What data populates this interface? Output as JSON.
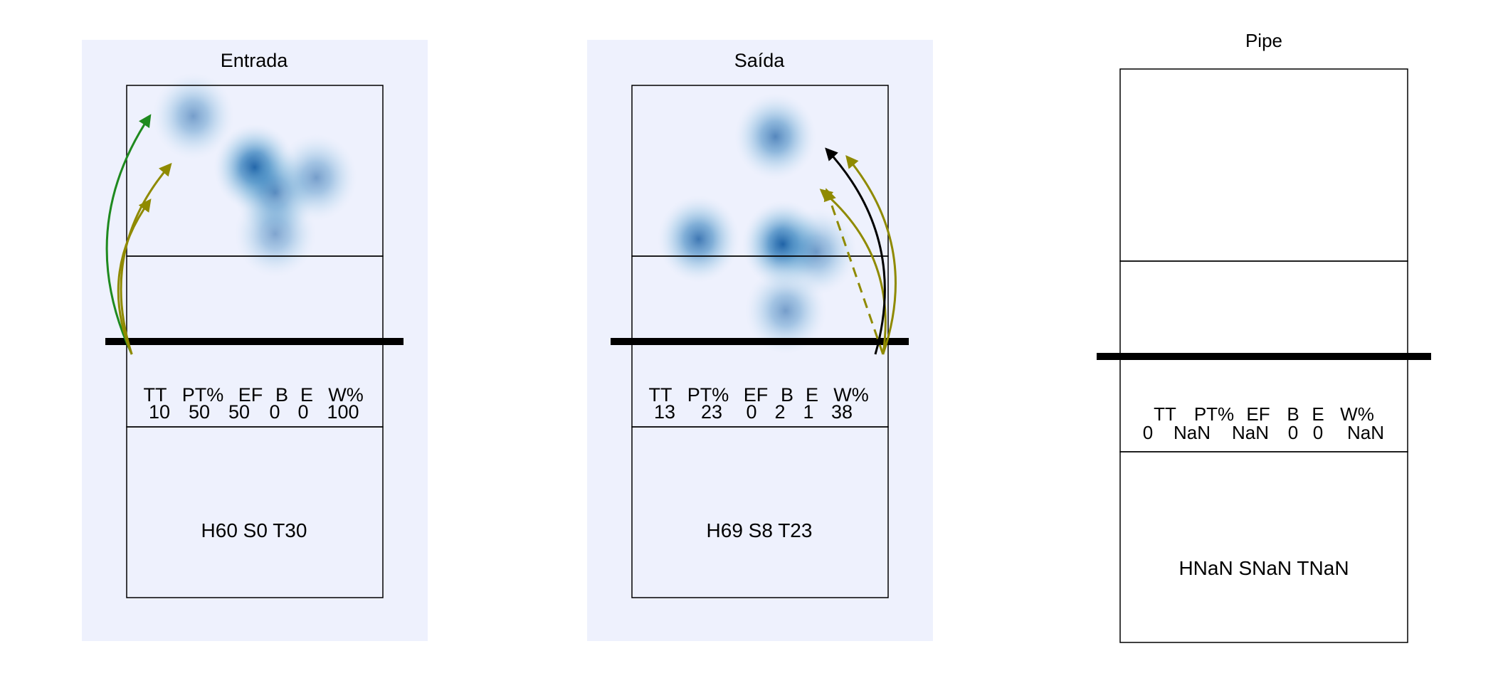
{
  "chart_data": [
    {
      "type": "heatmap",
      "title": "Entrada",
      "stats_header": [
        "TT",
        "PT%",
        "EF",
        "B",
        "E",
        "W%"
      ],
      "stats_values": [
        "10",
        "50",
        "50",
        "0",
        "0",
        "100"
      ],
      "footer": "H60 S0 T30",
      "heat_blobs": [
        {
          "x": 0.26,
          "y": 0.88,
          "weight": 0.55
        },
        {
          "x": 0.5,
          "y": 0.68,
          "weight": 1.0
        },
        {
          "x": 0.58,
          "y": 0.58,
          "weight": 0.65
        },
        {
          "x": 0.74,
          "y": 0.64,
          "weight": 0.55
        },
        {
          "x": 0.58,
          "y": 0.42,
          "weight": 0.5
        }
      ],
      "arrows": [
        {
          "color": "#1f8a1f",
          "dashed": false,
          "from": [
            0.02,
            0.42
          ],
          "to": [
            0.09,
            0.88
          ]
        },
        {
          "color": "#8f8a00",
          "dashed": false,
          "from": [
            0.02,
            0.42
          ],
          "to": [
            0.17,
            0.69
          ]
        },
        {
          "color": "#8f8a00",
          "dashed": false,
          "from": [
            0.02,
            0.42
          ],
          "to": [
            0.09,
            0.55
          ]
        }
      ]
    },
    {
      "type": "heatmap",
      "title": "Saída",
      "stats_header": [
        "TT",
        "PT%",
        "EF",
        "B",
        "E",
        "W%"
      ],
      "stats_values": [
        "13",
        "23",
        "0",
        "2",
        "1",
        "38"
      ],
      "footer": "H69 S8 T23",
      "heat_blobs": [
        {
          "x": 0.56,
          "y": 0.8,
          "weight": 0.7
        },
        {
          "x": 0.26,
          "y": 0.4,
          "weight": 0.8
        },
        {
          "x": 0.59,
          "y": 0.38,
          "weight": 1.0
        },
        {
          "x": 0.72,
          "y": 0.35,
          "weight": 0.55
        },
        {
          "x": 0.6,
          "y": 0.12,
          "weight": 0.55
        }
      ],
      "arrows": [
        {
          "color": "#8f8a00",
          "dashed": false,
          "from": [
            0.98,
            0.42
          ],
          "to": [
            0.74,
            0.59
          ]
        },
        {
          "color": "#8f8a00",
          "dashed": true,
          "from": [
            0.98,
            0.42
          ],
          "to": [
            0.76,
            0.59
          ]
        },
        {
          "color": "#8f8a00",
          "dashed": false,
          "from": [
            0.98,
            0.42
          ],
          "to": [
            0.84,
            0.72
          ]
        },
        {
          "color": "#000000",
          "dashed": false,
          "from": [
            0.95,
            0.48
          ],
          "to": [
            0.76,
            0.75
          ]
        }
      ]
    },
    {
      "type": "heatmap",
      "title": "Pipe",
      "stats_header": [
        "TT",
        "PT%",
        "EF",
        "B",
        "E",
        "W%"
      ],
      "stats_values": [
        "0",
        "NaN",
        "NaN",
        "0",
        "0",
        "NaN"
      ],
      "footer": "HNaN SNaN TNaN",
      "heat_blobs": [],
      "arrows": []
    }
  ]
}
